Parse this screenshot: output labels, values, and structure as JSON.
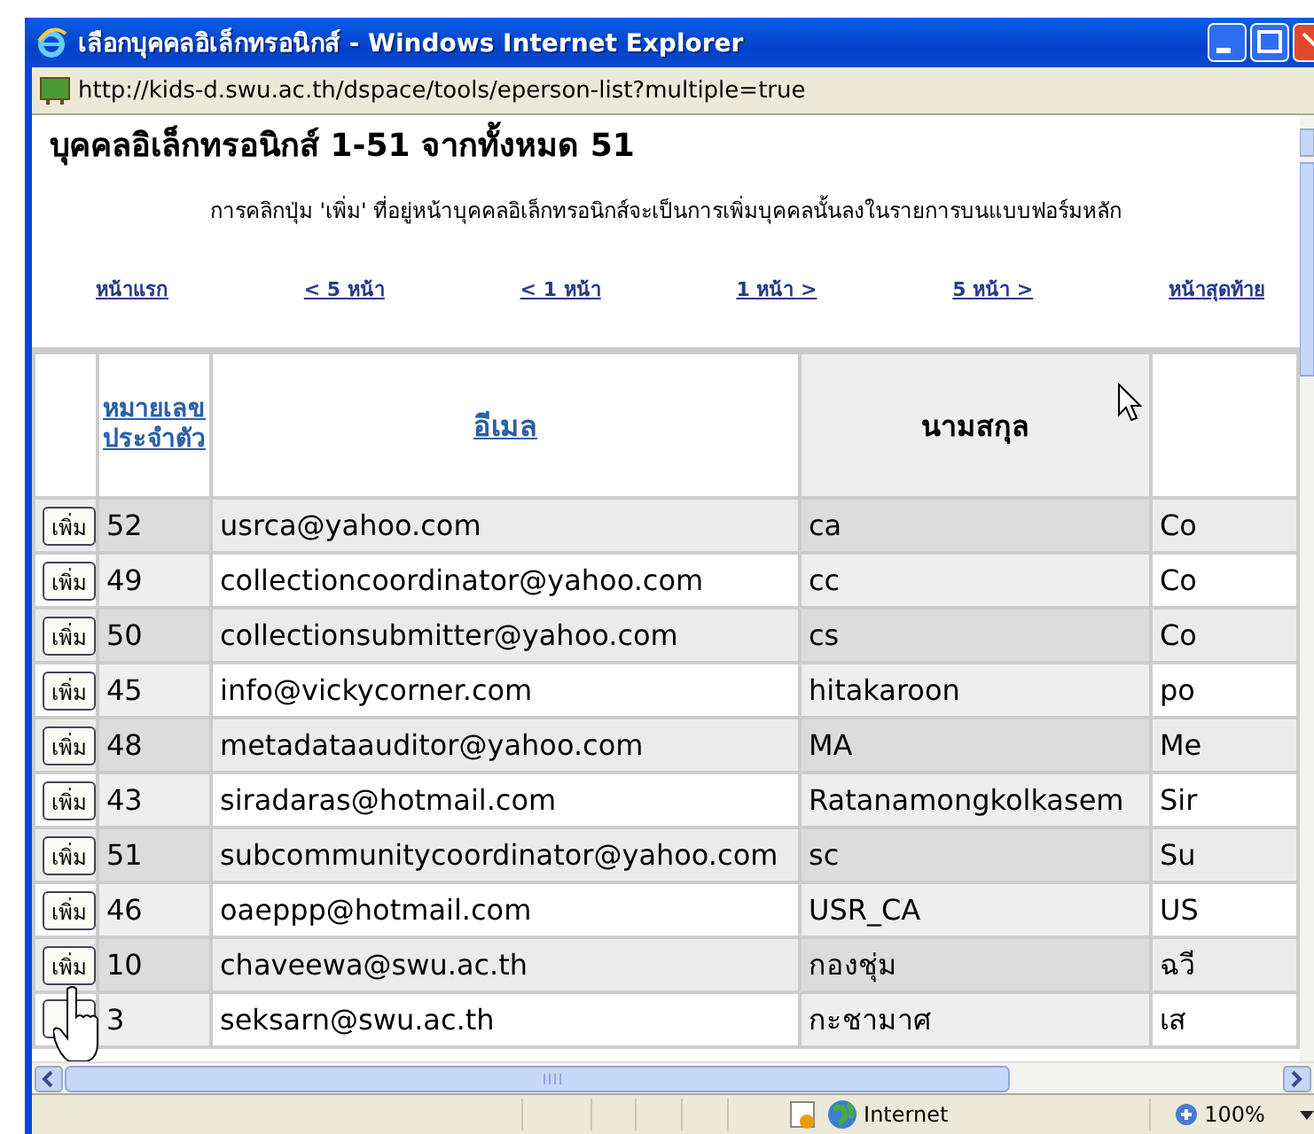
{
  "window": {
    "title": "เลือกบุคคลอิเล็กทรอนิกส์ - Windows Internet Explorer",
    "address": "http://kids-d.swu.ac.th/dspace/tools/eperson-list?multiple=true"
  },
  "page": {
    "heading": "บุคคลอิเล็กทรอนิกส์ 1-51 จากทั้งหมด 51",
    "instruction": "การคลิกปุ่ม 'เพิ่ม' ที่อยู่หน้าบุคคลอิเล็กทรอนิกส์จะเป็นการเพิ่มบุคคลนั้นลงในรายการบนแบบฟอร์มหลัก",
    "pager": [
      "หน้าแรก",
      "< 5 หน้า",
      "< 1 หน้า",
      "1 หน้า >",
      "5 หน้า >",
      "หน้าสุดท้าย"
    ]
  },
  "table": {
    "columns": [
      {
        "label": "หมายเลขประจำตัว",
        "link": true
      },
      {
        "label": "อีเมล",
        "link": true
      },
      {
        "label": "นามสกุล",
        "link": false
      }
    ],
    "rows": [
      {
        "button": "เพิ่ม",
        "id": "52",
        "email": "usrca@yahoo.com",
        "last_name": "ca",
        "column_5": "Co"
      },
      {
        "button": "เพิ่ม",
        "id": "49",
        "email": "collectioncoordinator@yahoo.com",
        "last_name": "cc",
        "column_5": "Co"
      },
      {
        "button": "เพิ่ม",
        "id": "50",
        "email": "collectionsubmitter@yahoo.com",
        "last_name": "cs",
        "column_5": "Co"
      },
      {
        "button": "เพิ่ม",
        "id": "45",
        "email": "info@vickycorner.com",
        "last_name": "hitakaroon",
        "column_5": "po"
      },
      {
        "button": "เพิ่ม",
        "id": "48",
        "email": "metadataauditor@yahoo.com",
        "last_name": "MA",
        "column_5": "Me"
      },
      {
        "button": "เพิ่ม",
        "id": "43",
        "email": "siradaras@hotmail.com",
        "last_name": "Ratanamongkolkasem",
        "column_5": "Sir"
      },
      {
        "button": "เพิ่ม",
        "id": "51",
        "email": "subcommunitycoordinator@yahoo.com",
        "last_name": "sc",
        "column_5": "Su"
      },
      {
        "button": "เพิ่ม",
        "id": "46",
        "email": "oaeppp@hotmail.com",
        "last_name": "USR_CA",
        "column_5": "US"
      },
      {
        "button": "เพิ่ม",
        "id": "10",
        "email": "chaveewa@swu.ac.th",
        "last_name": "กองชุ่ม",
        "column_5": "ฉวี"
      },
      {
        "id": "3",
        "email": "seksarn@swu.ac.th",
        "last_name": "กะชามาศ",
        "column_5": "เส"
      }
    ]
  },
  "status_bar": {
    "zone": "Internet",
    "zoom": "100%"
  }
}
